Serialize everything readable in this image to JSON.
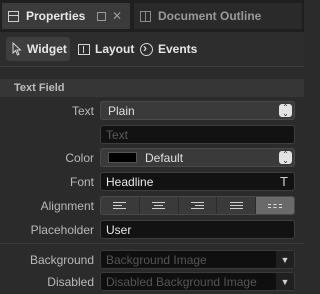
{
  "tabs": [
    {
      "label": "Properties",
      "icon": "properties-panel-icon"
    },
    {
      "label": "Document Outline",
      "icon": "document-outline-icon"
    }
  ],
  "subtabs": [
    {
      "label": "Widget",
      "icon": "cursor-pointer-icon"
    },
    {
      "label": "Layout",
      "icon": "layout-icon"
    },
    {
      "label": "Events",
      "icon": "events-arrow-icon"
    }
  ],
  "section": {
    "title": "Text Field"
  },
  "fields": {
    "text": {
      "label": "Text",
      "value": "Plain"
    },
    "text_input": {
      "placeholder": "Text"
    },
    "color": {
      "label": "Color",
      "value": "Default",
      "swatch": "#000000"
    },
    "font": {
      "label": "Font",
      "value": "Headline"
    },
    "alignment": {
      "label": "Alignment",
      "selected_index": 4
    },
    "placeholder": {
      "label": "Placeholder",
      "value": "User"
    },
    "background": {
      "label": "Background",
      "placeholder": "Background Image"
    },
    "disabled": {
      "label": "Disabled",
      "placeholder": "Disabled Background Image"
    }
  }
}
